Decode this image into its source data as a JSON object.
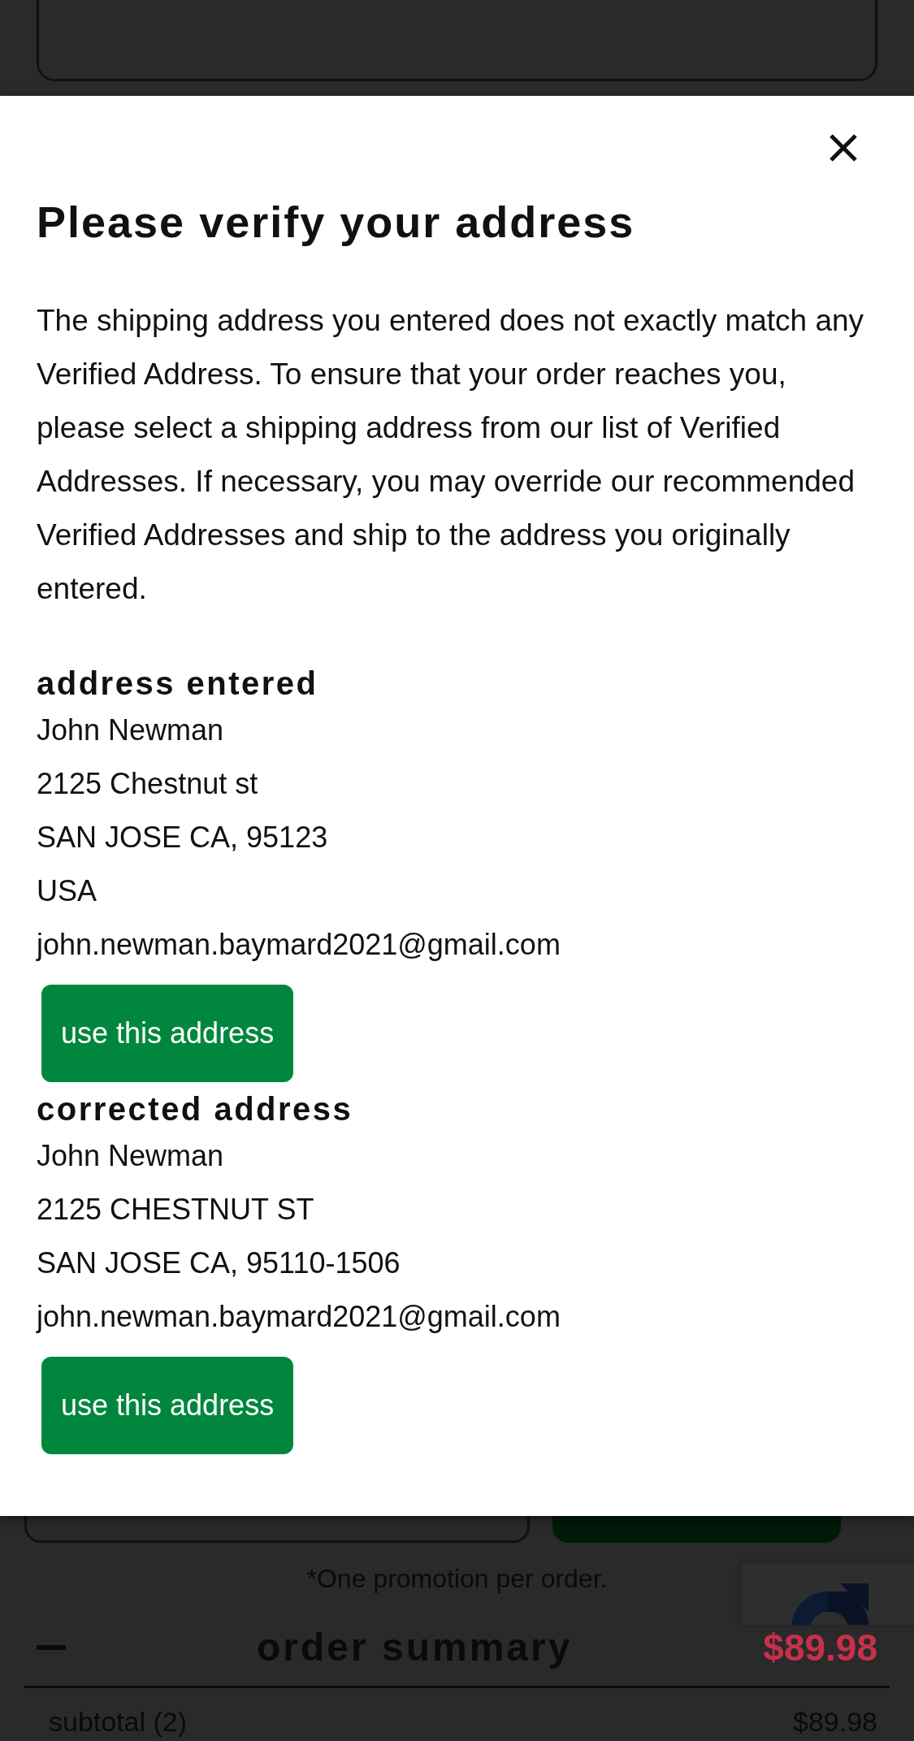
{
  "page": {
    "promo_note": "*One promotion per order.",
    "order_summary": {
      "title": "order summary",
      "total": "$89.98",
      "expanded": true
    },
    "subtotal": {
      "label": "subtotal (2)",
      "value": "$89.98"
    }
  },
  "dialog": {
    "title": "Please verify your address",
    "message": "The shipping address you entered does not exactly match any Verified Address. To ensure that your order reaches you, please select a shipping address from our list of Verified Addresses. If necessary, you may override our recommended Verified Addresses and ship to the address you originally entered.",
    "addresses": [
      {
        "heading": "address entered",
        "lines": [
          "John Newman",
          "2125 Chestnut st",
          "SAN JOSE CA, 95123",
          "USA",
          "john.newman.baymard2021@gmail.com"
        ],
        "button": "use this address"
      },
      {
        "heading": "corrected address",
        "lines": [
          "John Newman",
          "2125 CHESTNUT ST",
          "SAN JOSE CA, 95110-1506",
          "john.newman.baymard2021@gmail.com"
        ],
        "button": "use this address"
      }
    ]
  }
}
